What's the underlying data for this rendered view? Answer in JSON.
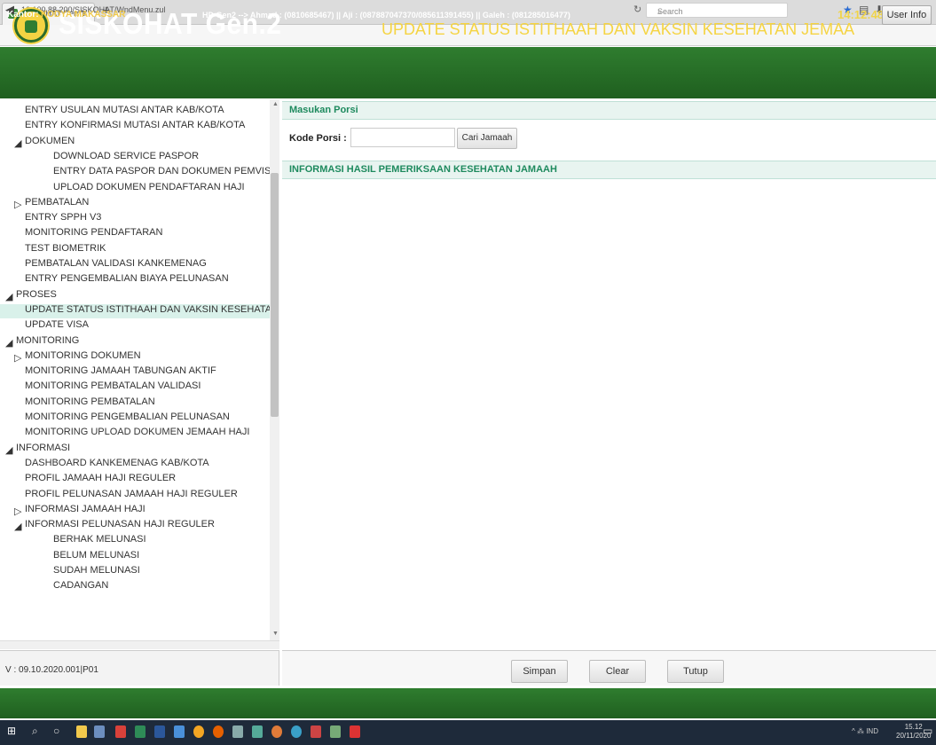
{
  "browser": {
    "tab_title": "SISKOHAT Gen.2",
    "tab_close": "×",
    "new_tab": "+",
    "url": "10.100.88.200/SISKOHAT/WndMenu.zul",
    "search_placeholder": "Search",
    "window_controls": [
      "–",
      "□",
      "×"
    ]
  },
  "header": {
    "app_title": "SISKOHAT Gen.2",
    "page_title": "UPDATE STATUS ISTITHAAH DAN VAKSIN KESEHATAN JEMAA"
  },
  "sidebar": {
    "items": [
      {
        "label": "ENTRY USULAN MUTASI ANTAR KAB/KOTA",
        "arrow": ""
      },
      {
        "label": "ENTRY KONFIRMASI MUTASI ANTAR KAB/KOTA",
        "arrow": ""
      },
      {
        "label": "DOKUMEN",
        "arrow": "◢"
      },
      {
        "label": "DOWNLOAD SERVICE PASPOR",
        "arrow": ""
      },
      {
        "label": "ENTRY DATA PASPOR DAN DOKUMEN PEMVISAAN",
        "arrow": ""
      },
      {
        "label": "UPLOAD DOKUMEN PENDAFTARAN HAJI",
        "arrow": ""
      },
      {
        "label": "PEMBATALAN",
        "arrow": "▷"
      },
      {
        "label": "ENTRY SPPH V3",
        "arrow": ""
      },
      {
        "label": "MONITORING PENDAFTARAN",
        "arrow": ""
      },
      {
        "label": "TEST BIOMETRIK",
        "arrow": ""
      },
      {
        "label": "PEMBATALAN VALIDASI KANKEMENAG",
        "arrow": ""
      },
      {
        "label": "ENTRY PENGEMBALIAN BIAYA PELUNASAN",
        "arrow": ""
      },
      {
        "label": "PROSES",
        "arrow": "◢"
      },
      {
        "label": "UPDATE STATUS ISTITHAAH DAN VAKSIN KESEHATAN JEMAAH",
        "arrow": ""
      },
      {
        "label": "UPDATE VISA",
        "arrow": ""
      },
      {
        "label": "MONITORING",
        "arrow": "◢"
      },
      {
        "label": "MONITORING DOKUMEN",
        "arrow": "▷"
      },
      {
        "label": "MONITORING JAMAAH TABUNGAN AKTIF",
        "arrow": ""
      },
      {
        "label": "MONITORING PEMBATALAN VALIDASI",
        "arrow": ""
      },
      {
        "label": "MONITORING PEMBATALAN",
        "arrow": ""
      },
      {
        "label": "MONITORING PENGEMBALIAN PELUNASAN",
        "arrow": ""
      },
      {
        "label": "MONITORING UPLOAD DOKUMEN JEMAAH HAJI",
        "arrow": ""
      },
      {
        "label": "INFORMASI",
        "arrow": "◢"
      },
      {
        "label": "DASHBOARD KANKEMENAG KAB/KOTA",
        "arrow": ""
      },
      {
        "label": "PROFIL JAMAAH HAJI REGULER",
        "arrow": ""
      },
      {
        "label": "PROFIL PELUNASAN JAMAAH HAJI REGULER",
        "arrow": ""
      },
      {
        "label": "INFORMASI JAMAAH HAJI",
        "arrow": "▷"
      },
      {
        "label": "INFORMASI PELUNASAN HAJI REGULER",
        "arrow": "◢"
      },
      {
        "label": "BERHAK MELUNASI",
        "arrow": ""
      },
      {
        "label": "BELUM MELUNASI",
        "arrow": ""
      },
      {
        "label": "SUDAH MELUNASI",
        "arrow": ""
      },
      {
        "label": "CADANGAN",
        "arrow": ""
      }
    ],
    "version": "V : 09.10.2020.001|P01"
  },
  "main": {
    "section1_title": "Masukan Porsi",
    "kode_label": "Kode Porsi :",
    "kode_value": "",
    "cari_button": "Cari Jamaah",
    "section2_title": "INFORMASI HASIL PEMERIKSAAN KESEHATAN JAMAAH"
  },
  "footer_buttons": {
    "simpan": "Simpan",
    "clear": "Clear",
    "tutup": "Tutup"
  },
  "status_bar": {
    "kantor_label": "Kantor:",
    "kantor_value": "KODYA MAKASSAR",
    "helpdesk": "HD Gen2 --> Ahmad : (0810685467) || Aji : (087887047370/085611391455) || Galeh : (081285016477)",
    "clock": "14:12:48",
    "user_info": "User Info"
  },
  "taskbar": {
    "tray": "^ ⁂ IND",
    "time": "15.12",
    "date": "20/11/2020"
  },
  "colors": {
    "header_green": "#2f7d2f",
    "title_yellow": "#f5d443",
    "section_green_text": "#1e8a5e",
    "selected_row": "#d9f1ea"
  }
}
